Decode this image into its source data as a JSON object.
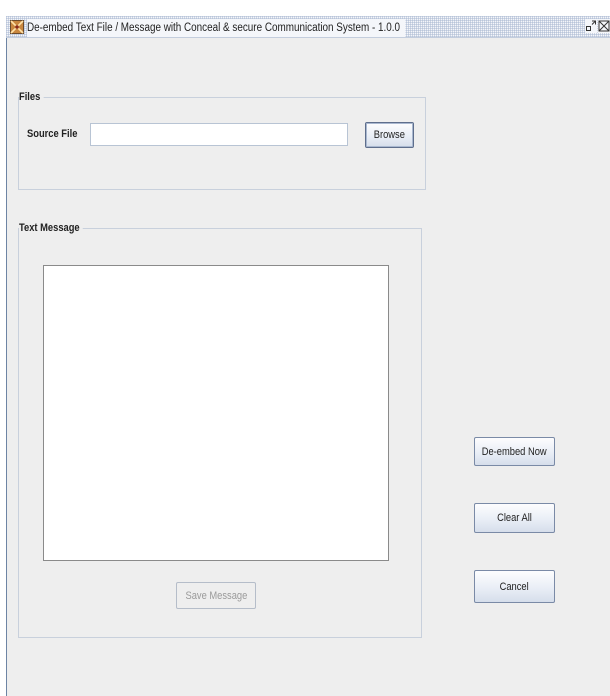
{
  "window": {
    "title": "De-embed  Text File / Message with Conceal & secure Communication System - 1.0.0"
  },
  "files_group": {
    "legend": "Files",
    "source_label": "Source File",
    "source_value": "",
    "browse_label": "Browse"
  },
  "text_group": {
    "legend": "Text Message",
    "message_value": "",
    "save_label": "Save Message"
  },
  "actions": {
    "deembed_label": "De-embed Now",
    "clear_label": "Clear All",
    "cancel_label": "Cancel"
  },
  "icons": {
    "app": "app-icon",
    "restore": "restore-icon",
    "close": "close-icon"
  },
  "colors": {
    "window_bg": "#eeeeee",
    "title_pattern": "#a0b0cc",
    "button_border": "#7a8aa6",
    "disabled_text": "#9a9a9a"
  }
}
